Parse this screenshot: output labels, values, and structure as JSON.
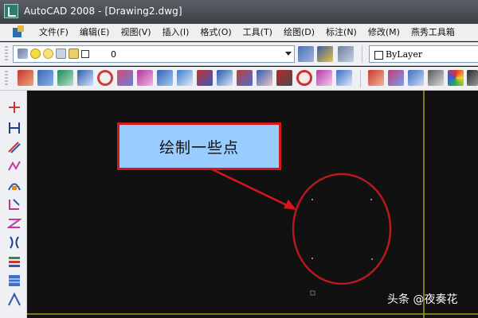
{
  "window": {
    "title": "AutoCAD 2008 - [Drawing2.dwg]"
  },
  "menubar": {
    "items": [
      "文件(F)",
      "编辑(E)",
      "视图(V)",
      "插入(I)",
      "格式(O)",
      "工具(T)",
      "绘图(D)",
      "标注(N)",
      "修改(M)",
      "燕秀工具箱"
    ]
  },
  "layer_toolbar": {
    "current_layer": "0",
    "icons": [
      "layers-icon",
      "bulb-icon",
      "sun-icon",
      "unlock-icon",
      "lock-icon",
      "color-box-icon"
    ]
  },
  "properties_toolbar": {
    "color_value": "ByLayer"
  },
  "callout": {
    "text": "绘制一些点"
  },
  "watermark": {
    "text": "头条 @夜奏花"
  },
  "colors": {
    "canvas_background": "#101010",
    "callout_fill": "#99ccff",
    "annotation_red": "#d6171c",
    "grid_line_yellow": "#a89b1f",
    "point_gray": "#8a8a8a"
  }
}
